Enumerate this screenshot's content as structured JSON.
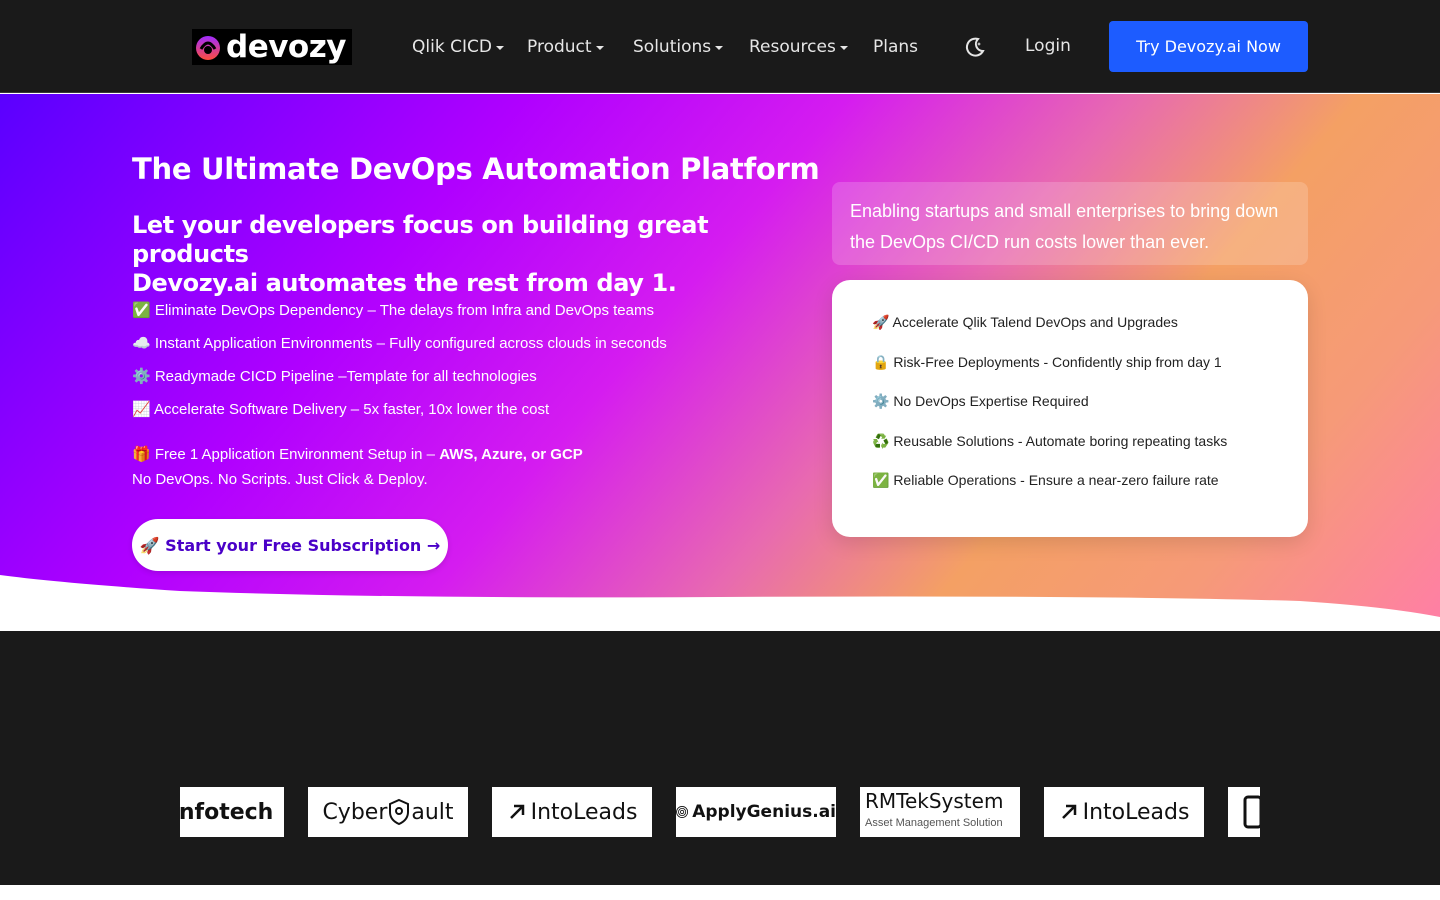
{
  "nav": {
    "brand": "devozy",
    "items": [
      {
        "label": "Qlik CICD",
        "dropdown": true
      },
      {
        "label": "Product",
        "dropdown": true
      },
      {
        "label": "Solutions",
        "dropdown": true
      },
      {
        "label": "Resources",
        "dropdown": true
      },
      {
        "label": "Plans",
        "dropdown": false
      }
    ],
    "theme_icon": "moon-icon",
    "login": "Login",
    "cta": "Try Devozy.ai Now"
  },
  "hero": {
    "title": "The Ultimate DevOps Automation Platform",
    "subtitle_line1": "Let your developers focus on building great products",
    "subtitle_line2": "Devozy.ai automates the rest from day 1.",
    "bullets": [
      "✅ Eliminate DevOps Dependency – The delays from Infra and DevOps teams",
      "☁️ Instant Application Environments – Fully configured across clouds in seconds",
      "⚙️ Readymade CICD Pipeline –Template for all technologies",
      "📈 Accelerate Software Delivery – 5x faster, 10x lower the cost"
    ],
    "free_prefix": "🎁 Free 1 Application Environment Setup in – ",
    "free_clouds": "AWS, Azure, or GCP",
    "no_scripts": "No DevOps. No Scripts. Just Click & Deploy.",
    "cta": "🚀 Start your Free Subscription →",
    "enable_text": "Enabling startups and small enterprises to bring down the DevOps CI/CD run costs lower than ever.",
    "features": [
      "🚀 Accelerate Qlik Talend DevOps and Upgrades",
      "🔒 Risk-Free Deployments - Confidently ship from day 1",
      "⚙️ No DevOps Expertise Required",
      "♻️ Reusable Solutions - Automate boring repeating tasks",
      "✅ Reliable Operations - Ensure a near-zero failure rate"
    ]
  },
  "clients": {
    "logos": [
      {
        "name": "Infotech"
      },
      {
        "name": "CyberVault",
        "display": "Cyber",
        "display2": "ault"
      },
      {
        "name": "IntoLeads"
      },
      {
        "name": "ApplyGenius.ai"
      },
      {
        "name": "RMTekSystem",
        "tagline": "Asset Management Solution"
      },
      {
        "name": "IntoLeads"
      }
    ]
  },
  "colors": {
    "nav_bg": "#1a1a1a",
    "cta_blue": "#1d5cff",
    "hero_start": "#5a00ff",
    "hero_mid": "#d51cf0",
    "hero_end": "#ff7ea6"
  }
}
